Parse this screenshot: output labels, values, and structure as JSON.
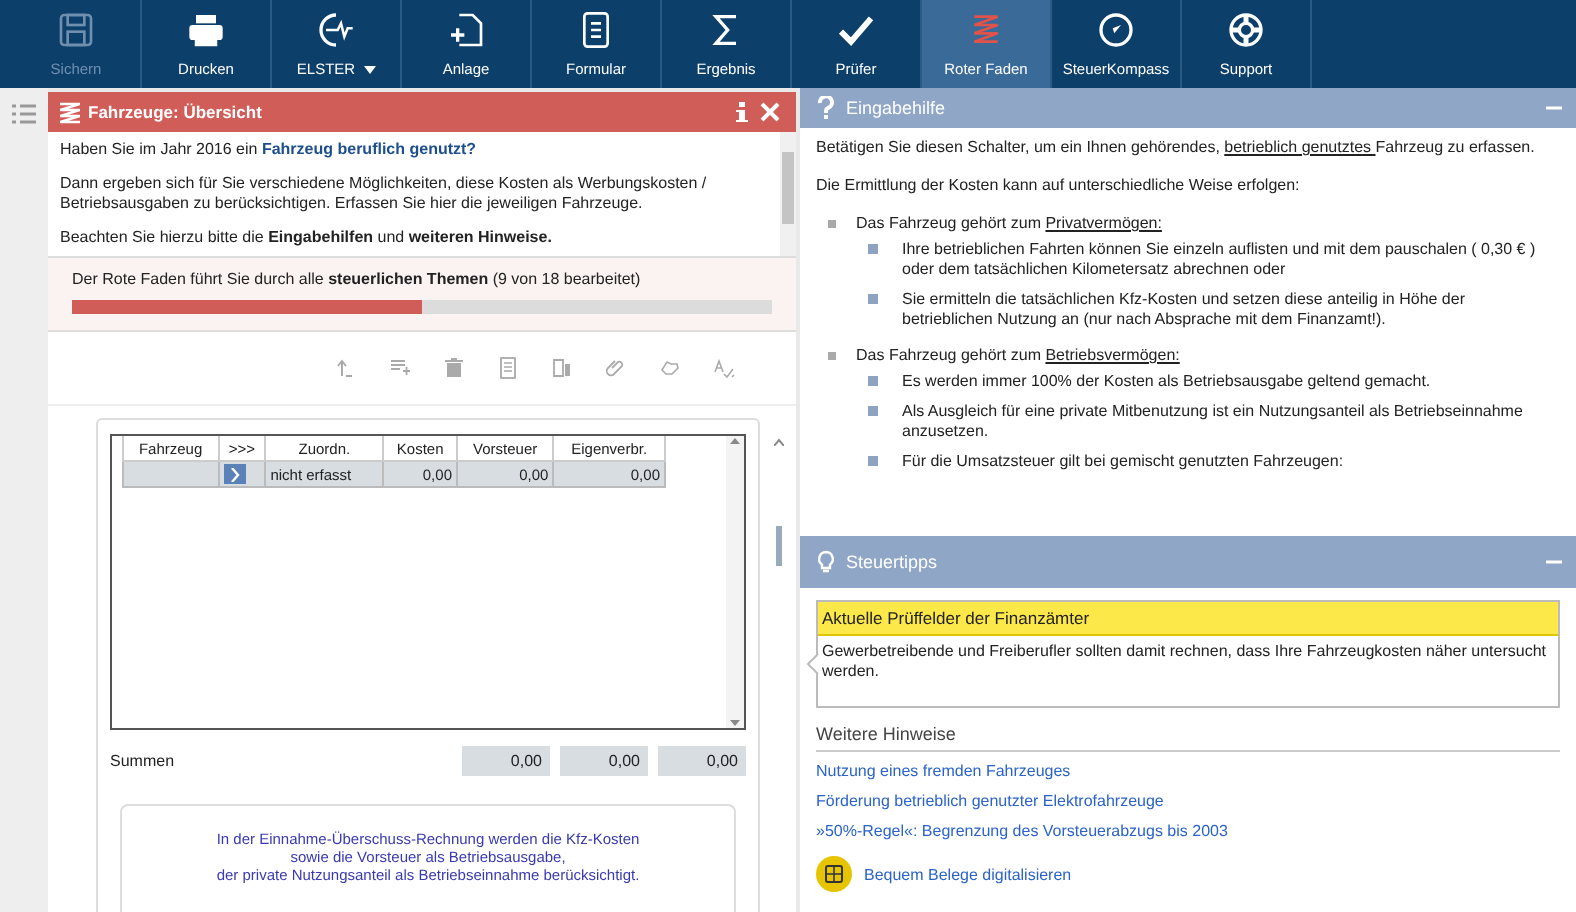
{
  "toolbar": {
    "buttons": [
      {
        "label": "Sichern",
        "kind": "button",
        "disabled": true,
        "selected": false
      },
      {
        "label": "Drucken",
        "kind": "button",
        "disabled": false,
        "selected": false
      },
      {
        "label": "ELSTER",
        "kind": "dropdown",
        "disabled": false,
        "selected": false
      },
      {
        "label": "Anlage",
        "kind": "button",
        "disabled": false,
        "selected": false
      },
      {
        "label": "Formular",
        "kind": "button",
        "disabled": false,
        "selected": false
      },
      {
        "label": "Ergebnis",
        "kind": "button",
        "disabled": false,
        "selected": false
      },
      {
        "label": "Prüfer",
        "kind": "button",
        "disabled": false,
        "selected": false
      },
      {
        "label": "Roter Faden",
        "kind": "button",
        "disabled": false,
        "selected": true
      },
      {
        "label": "SteuerKompass",
        "kind": "button",
        "disabled": false,
        "selected": false
      },
      {
        "label": "Support",
        "kind": "button",
        "disabled": false,
        "selected": false
      }
    ]
  },
  "main_panel": {
    "title": "Fahrzeuge: Übersicht",
    "intro": [
      {
        "kind": "question",
        "text": "Haben Sie im Jahr 2016 ein **Fahrzeug beruflich genutzt?**"
      },
      {
        "kind": "plain",
        "text": "Dann ergeben sich für Sie verschiedene Möglichkeiten, diese Kosten als Werbungskosten / Betriebsausgaben zu berücksichtigen. Erfassen Sie hier die jeweiligen Fahrzeuge."
      },
      {
        "kind": "plain",
        "text": "Beachten Sie hierzu bitte die **Eingabehilfen** und **weiteren Hinweise.**"
      }
    ],
    "progress": {
      "text": "Der Rote Faden führt Sie durch alle **steuerlichen Themen** (9 von 18 bearbeitet)",
      "level": 0.5
    },
    "table": {
      "columns": [
        "Fahrzeug",
        ">>>",
        "Zuordn.",
        "Kosten",
        "Vorsteuer",
        "Eigenverbr."
      ],
      "rows": [
        {
          "cells": [
            "",
            "",
            "nicht erfasst",
            "0,00",
            "0,00",
            "0,00"
          ]
        }
      ]
    },
    "sums": {
      "label": "Summen",
      "values": [
        "0,00",
        "0,00",
        "0,00"
      ]
    },
    "info": "In der Einnahme-Überschuss-Rechnung werden die Kfz-Kosten\nsowie die Vorsteuer als Betriebsausgabe,\nder private Nutzungsanteil als Betriebseinnahme berücksichtigt."
  },
  "help_panel": {
    "title": "Eingabehilfe",
    "intro": {
      "before": "Betätigen Sie diesen Schalter, um ein Ihnen gehörendes, ",
      "link": "betrieblich genutztes ",
      "after": "Fahrzeug zu erfassen."
    },
    "lead": "Die Ermittlung der Kosten kann auf unterschiedliche Weise erfolgen:",
    "items": [
      {
        "prefix": "Das Fahrzeug gehört zum ",
        "link": "Privatvermögen:",
        "children": [
          "Ihre betrieblichen Fahrten können Sie einzeln auflisten und mit dem pauschalen ( 0,30 € ) oder dem tatsächlichen Kilometersatz abrechnen oder",
          "Sie ermitteln die tatsächlichen Kfz-Kosten und setzen diese anteilig in Höhe der betrieblichen Nutzung an (nur nach Absprache mit dem Finanzamt!)."
        ]
      },
      {
        "prefix": "Das Fahrzeug gehört zum ",
        "link": "Betriebsvermögen:",
        "children": [
          "Es werden immer 100% der Kosten als Betriebsausgabe geltend gemacht.",
          "Als Ausgleich für eine private Mitbenutzung ist ein Nutzungsanteil als Betriebseinnahme anzusetzen.",
          "Für die Umsatzsteuer gilt bei gemischt genutzten Fahrzeugen:"
        ]
      }
    ]
  },
  "tips_panel": {
    "title": "Steuertipps",
    "tip_title": "Aktuelle Prüffelder der Finanzämter",
    "tip_text": "Gewerbetreibende und Freiberufler sollten damit rechnen, dass Ihre Fahrzeugkosten näher untersucht werden.",
    "more_heading": "Weitere Hinweise",
    "links": [
      "Nutzung eines fremden Fahrzeuges",
      "Förderung betrieblich genutzter Elektrofahrzeuge",
      "»50%-Regel«: Begrenzung des Vorsteuerabzugs bis 2003"
    ],
    "promo": "Bequem Belege digitalisieren"
  }
}
